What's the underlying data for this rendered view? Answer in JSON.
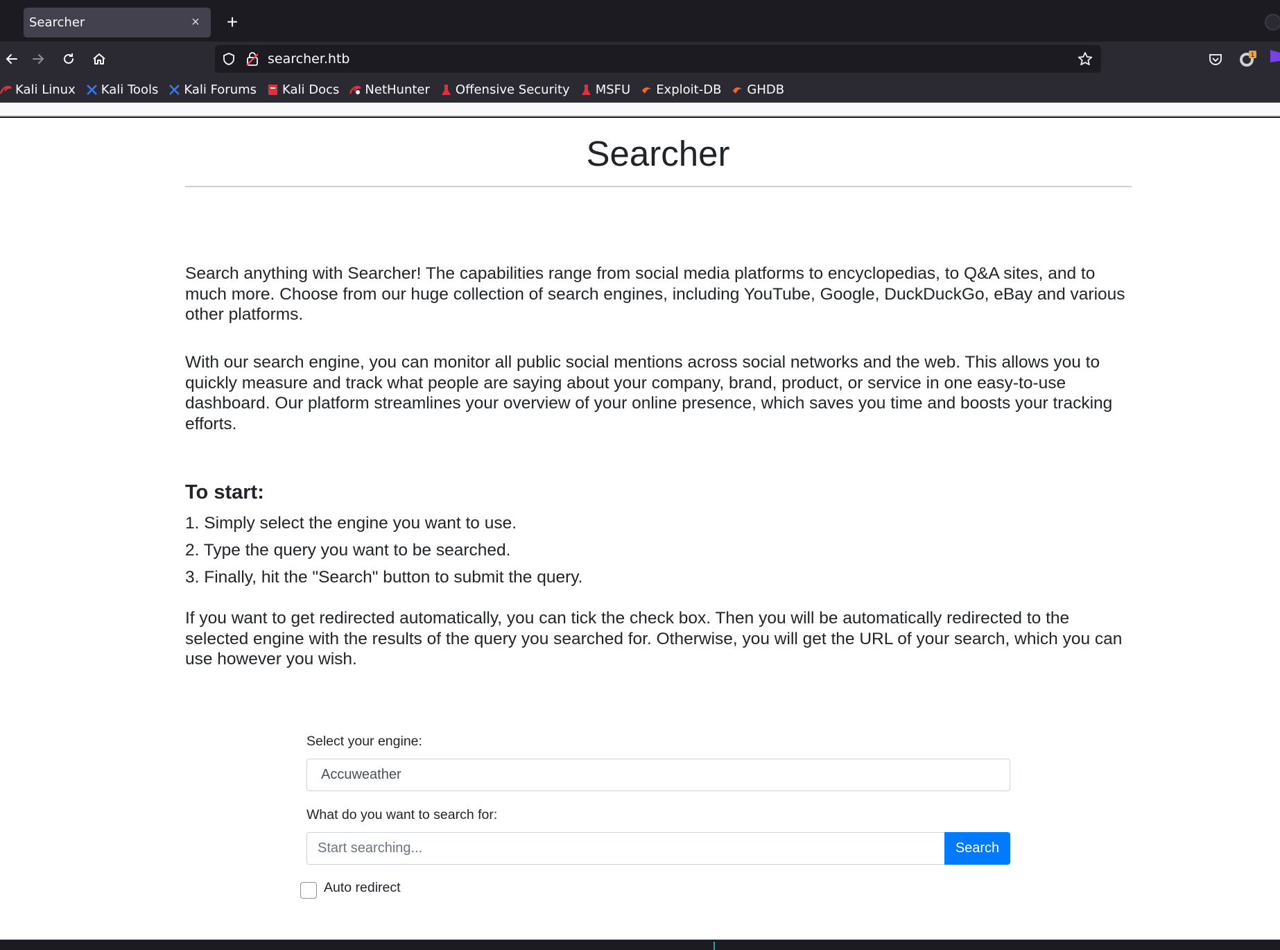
{
  "browser": {
    "tab_title": "Searcher",
    "tab_close": "×",
    "new_tab": "+",
    "url": "searcher.htb",
    "extension_badge": "1",
    "bookmarks": [
      {
        "label": "Kali Linux",
        "icon": "kali-dragon-icon"
      },
      {
        "label": "Kali Tools",
        "icon": "kali-tools-icon"
      },
      {
        "label": "Kali Forums",
        "icon": "kali-forums-icon"
      },
      {
        "label": "Kali Docs",
        "icon": "kali-docs-icon"
      },
      {
        "label": "NetHunter",
        "icon": "nethunter-icon"
      },
      {
        "label": "Offensive Security",
        "icon": "offsec-icon"
      },
      {
        "label": "MSFU",
        "icon": "msfu-icon"
      },
      {
        "label": "Exploit-DB",
        "icon": "exploit-db-icon"
      },
      {
        "label": "GHDB",
        "icon": "ghdb-icon"
      }
    ]
  },
  "page": {
    "title": "Searcher",
    "intro_1": "Search anything with Searcher! The capabilities range from social media platforms to encyclopedias, to Q&A sites, and to much more. Choose from our huge collection of search engines, including YouTube, Google, DuckDuckGo, eBay and various other platforms.",
    "intro_2": "With our search engine, you can monitor all public social mentions across social networks and the web. This allows you to quickly measure and track what people are saying about your company, brand, product, or service in one easy-to-use dashboard. Our platform streamlines your overview of your online presence, which saves you time and boosts your tracking efforts.",
    "to_start_heading": "To start:",
    "steps": [
      "1. Simply select the engine you want to use.",
      "2. Type the query you want to be searched.",
      "3. Finally, hit the \"Search\" button to submit the query."
    ],
    "redirect_info": "If you want to get redirected automatically, you can tick the check box. Then you will be automatically redirected to the selected engine with the results of the query you searched for. Otherwise, you will get the URL of your search, which you can use however you wish."
  },
  "form": {
    "engine_label": "Select your engine:",
    "engine_selected": "Accuweather",
    "query_label": "What do you want to search for:",
    "query_placeholder": "Start searching...",
    "query_value": "",
    "search_button": "Search",
    "auto_redirect_label": "Auto redirect",
    "auto_redirect_checked": false
  },
  "colors": {
    "primary_button": "#007bff",
    "chrome_dark": "#1c1b22",
    "chrome_mid": "#2b2a33",
    "text": "#212529"
  }
}
